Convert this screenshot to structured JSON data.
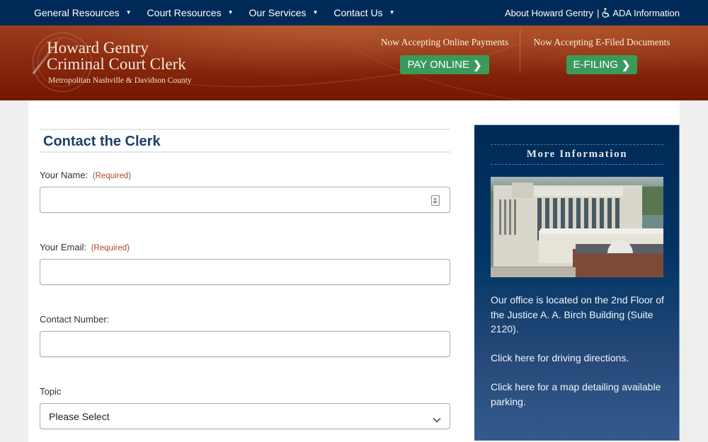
{
  "topnav": {
    "menu": [
      {
        "label": "General Resources"
      },
      {
        "label": "Court Resources"
      },
      {
        "label": "Our Services"
      },
      {
        "label": "Contact Us"
      }
    ],
    "about_label": "About Howard Gentry",
    "separator": "|",
    "ada_label": "ADA Information",
    "caret": "▼"
  },
  "header": {
    "logo_line1": "Howard Gentry",
    "logo_line2": "Criminal Court Clerk",
    "logo_subtitle": "Metropolitan Nashville & Davidson County",
    "pay": {
      "heading": "Now Accepting Online Payments",
      "button_label": "PAY ONLINE",
      "chevron": "❯"
    },
    "efile": {
      "heading": "Now Accepting E-Filed Documents",
      "button_label": "E-FILING",
      "chevron": "❯"
    }
  },
  "form": {
    "title": "Contact the Clerk",
    "fields": {
      "name": {
        "label": "Your Name:",
        "required": "(Required)",
        "value": "",
        "placeholder": ""
      },
      "email": {
        "label": "Your Email:",
        "required": "(Required)",
        "value": "",
        "placeholder": ""
      },
      "phone": {
        "label": "Contact Number:",
        "value": "",
        "placeholder": ""
      },
      "topic": {
        "label": "Topic",
        "selected": "Please Select"
      }
    }
  },
  "sidebar": {
    "title": "More Information",
    "photo_alt": "Justice A. A. Birch Building",
    "office_text": "Our office is located on the 2nd Floor of the Justice A. A. Birch Building (Suite 2120).",
    "directions_link": "Click here for driving directions.",
    "parking_link": "Click here for a map detailing available parking."
  },
  "colors": {
    "nav_bg": "#002a57",
    "banner_red": "#741600",
    "button_green": "#3a9a5c",
    "required_red": "#b3432f",
    "title_blue": "#1d3f66"
  }
}
